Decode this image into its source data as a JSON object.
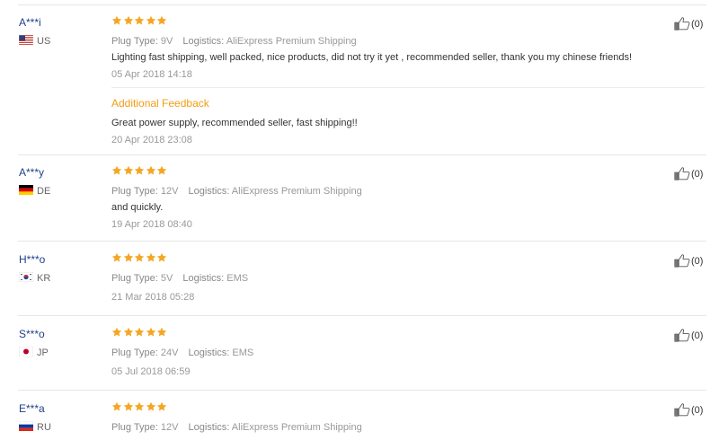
{
  "colors": {
    "star": "#f5a623",
    "username": "#1f3f8a",
    "feedback_title": "#f39c12"
  },
  "icons": {
    "star": "star-icon",
    "like": "thumbs-up-icon"
  },
  "reviews": [
    {
      "user": "A***i",
      "country": "US",
      "stars": 5,
      "plug_label": "Plug Type:",
      "plug_value": "9V",
      "logistics_label": "Logistics:",
      "logistics_value": "AliExpress Premium Shipping",
      "text": "Lighting fast shipping, well packed, nice products, did not try it yet , recommended seller, thank you my chinese friends!",
      "date": "05 Apr 2018 14:18",
      "helpful": "(0)",
      "additional": {
        "title": "Additional Feedback",
        "text": "Great power supply, recommended seller, fast shipping!!",
        "date": "20 Apr 2018 23:08"
      }
    },
    {
      "user": "A***y",
      "country": "DE",
      "stars": 5,
      "plug_label": "Plug Type:",
      "plug_value": "12V",
      "logistics_label": "Logistics:",
      "logistics_value": "AliExpress Premium Shipping",
      "text": "and quickly.",
      "date": "19 Apr 2018 08:40",
      "helpful": "(0)"
    },
    {
      "user": "H***o",
      "country": "KR",
      "stars": 5,
      "plug_label": "Plug Type:",
      "plug_value": "5V",
      "logistics_label": "Logistics:",
      "logistics_value": "EMS",
      "date": "21 Mar 2018 05:28",
      "helpful": "(0)"
    },
    {
      "user": "S***o",
      "country": "JP",
      "stars": 5,
      "plug_label": "Plug Type:",
      "plug_value": "24V",
      "logistics_label": "Logistics:",
      "logistics_value": "EMS",
      "date": "05 Jul 2018 06:59",
      "helpful": "(0)"
    },
    {
      "user": "E***a",
      "country": "RU",
      "stars": 5,
      "plug_label": "Plug Type:",
      "plug_value": "12V",
      "logistics_label": "Logistics:",
      "logistics_value": "AliExpress Premium Shipping",
      "helpful": "(0)"
    }
  ]
}
